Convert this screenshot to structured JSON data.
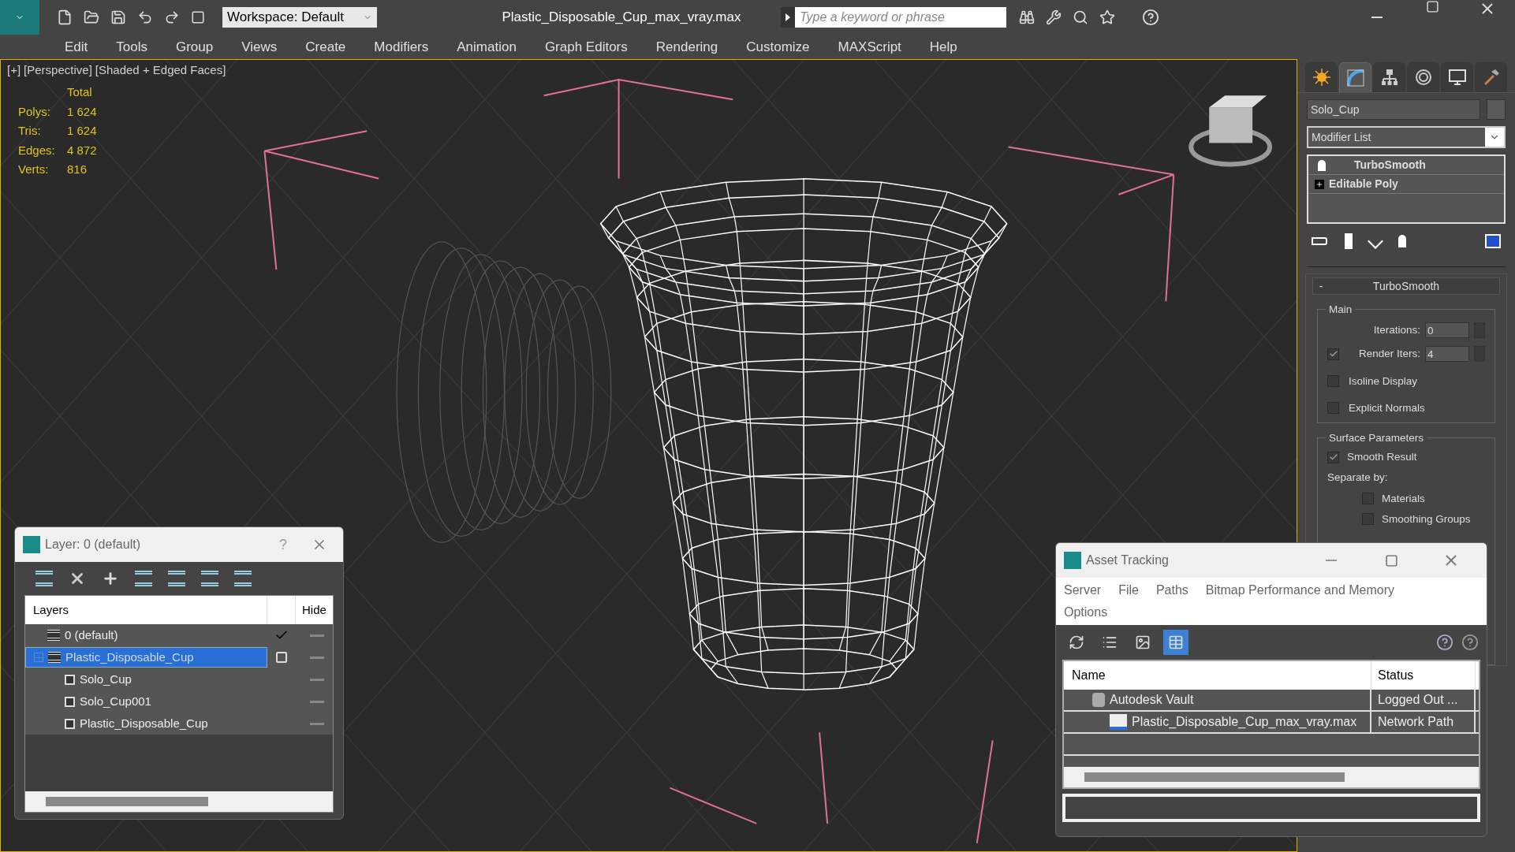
{
  "titlebar": {
    "title": "Plastic_Disposable_Cup_max_vray.max",
    "workspace": "Workspace: Default",
    "search": {
      "placeholder": "Type a keyword or phrase"
    }
  },
  "menu": [
    "Edit",
    "Tools",
    "Group",
    "Views",
    "Create",
    "Modifiers",
    "Animation",
    "Graph Editors",
    "Rendering",
    "Customize",
    "MAXScript",
    "Help"
  ],
  "viewport": {
    "labels": [
      "[+]",
      "[Perspective]",
      "[Shaded + Edged Faces]"
    ],
    "stats_header": "Total",
    "stats": [
      {
        "label": "Polys:",
        "value": "1 624"
      },
      {
        "label": "Tris:",
        "value": "1 624"
      },
      {
        "label": "Edges:",
        "value": "4 872"
      },
      {
        "label": "Verts:",
        "value": "816"
      }
    ]
  },
  "command_panel": {
    "tabs": [
      {
        "selected": false
      },
      {
        "selected": true
      },
      {
        "selected": false
      },
      {
        "selected": false
      },
      {
        "selected": false
      },
      {
        "selected": false
      }
    ],
    "object_name": "Solo_Cup",
    "modifier_list": "Modifier List",
    "stack": [
      {
        "label": "TurboSmooth",
        "kind": "modifier"
      },
      {
        "label": "Editable Poly",
        "kind": "base"
      }
    ],
    "rollout": {
      "title": "TurboSmooth",
      "toggle": "-",
      "main": {
        "title": "Main",
        "iterations": {
          "label": "Iterations:",
          "value": "0"
        },
        "render_iters": {
          "label": "Render Iters:",
          "value": "4",
          "checked": true
        },
        "options": [
          {
            "label": "Isoline Display",
            "checked": false
          },
          {
            "label": "Explicit Normals",
            "checked": false
          }
        ]
      },
      "surface": {
        "title": "Surface Parameters",
        "smooth_result": {
          "label": "Smooth Result",
          "checked": true
        },
        "separate_by": "Separate by:",
        "options": [
          {
            "label": "Materials",
            "checked": false
          },
          {
            "label": "Smoothing Groups",
            "checked": false
          }
        ]
      }
    }
  },
  "layer_dialog": {
    "title": "Layer: 0 (default)",
    "help": "?",
    "columns": [
      "Layers",
      "Hide"
    ],
    "tree": [
      {
        "name": "0 (default)",
        "kind": "layer",
        "current": true,
        "selected": false
      },
      {
        "name": "Plastic_Disposable_Cup",
        "kind": "layer",
        "current": false,
        "selected": true,
        "expanded": true,
        "children": [
          {
            "name": "Solo_Cup",
            "kind": "object",
            "selected": false
          },
          {
            "name": "Solo_Cup001",
            "kind": "object",
            "selected": false
          },
          {
            "name": "Plastic_Disposable_Cup",
            "kind": "object",
            "selected": false
          }
        ]
      }
    ]
  },
  "asset_dialog": {
    "title": "Asset Tracking",
    "menu": [
      "Server",
      "File",
      "Paths",
      "Bitmap Performance and Memory",
      "Options"
    ],
    "views": [
      {
        "selected": false
      },
      {
        "selected": false
      },
      {
        "selected": false
      },
      {
        "selected": true
      }
    ],
    "columns": [
      "Name",
      "Status"
    ],
    "rows": [
      {
        "name": "Autodesk Vault",
        "status": "Logged Out ...",
        "kind": "vault",
        "children": [
          {
            "name": "Plastic_Disposable_Cup_max_vray.max",
            "status": "Network Path",
            "kind": "file"
          }
        ]
      }
    ]
  }
}
